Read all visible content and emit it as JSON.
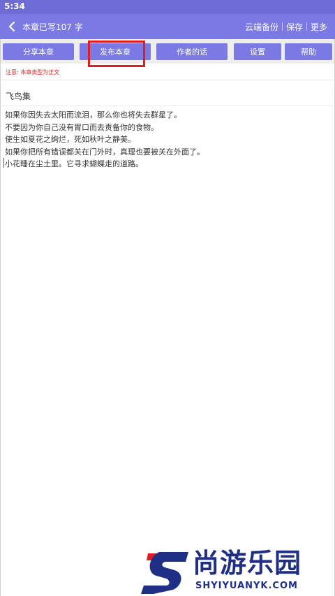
{
  "status_bar": {
    "time": "5:34"
  },
  "header": {
    "title": "本章已写107 字",
    "actions": [
      "云端备份",
      "保存",
      "更多"
    ]
  },
  "toolbar": {
    "buttons": [
      "分享本章",
      "发布本章",
      "作者的话",
      "设置",
      "帮助"
    ]
  },
  "notice": "注意: 本章类型为正文",
  "chapter": {
    "title": "飞鸟集",
    "lines": [
      "如果你因失去太阳而流泪，那么你也将失去群星了。",
      "不要因为你自己没有胃口而去责备你的食物。",
      "使生如夏花之绚烂，死如秋叶之静美。",
      "如果你把所有错误都关在门外时，真理也要被关在外面了。",
      "小花睡在尘土里。它寻求蝴蝶走的道路。"
    ]
  },
  "watermark": {
    "cn": "尚游乐园",
    "en": "SHYIYUANYK.COM"
  },
  "colors": {
    "header": "#7b79e3",
    "status_bar": "#6d6bd6",
    "highlight": "#e01e1e",
    "watermark": "#1f2f86"
  }
}
